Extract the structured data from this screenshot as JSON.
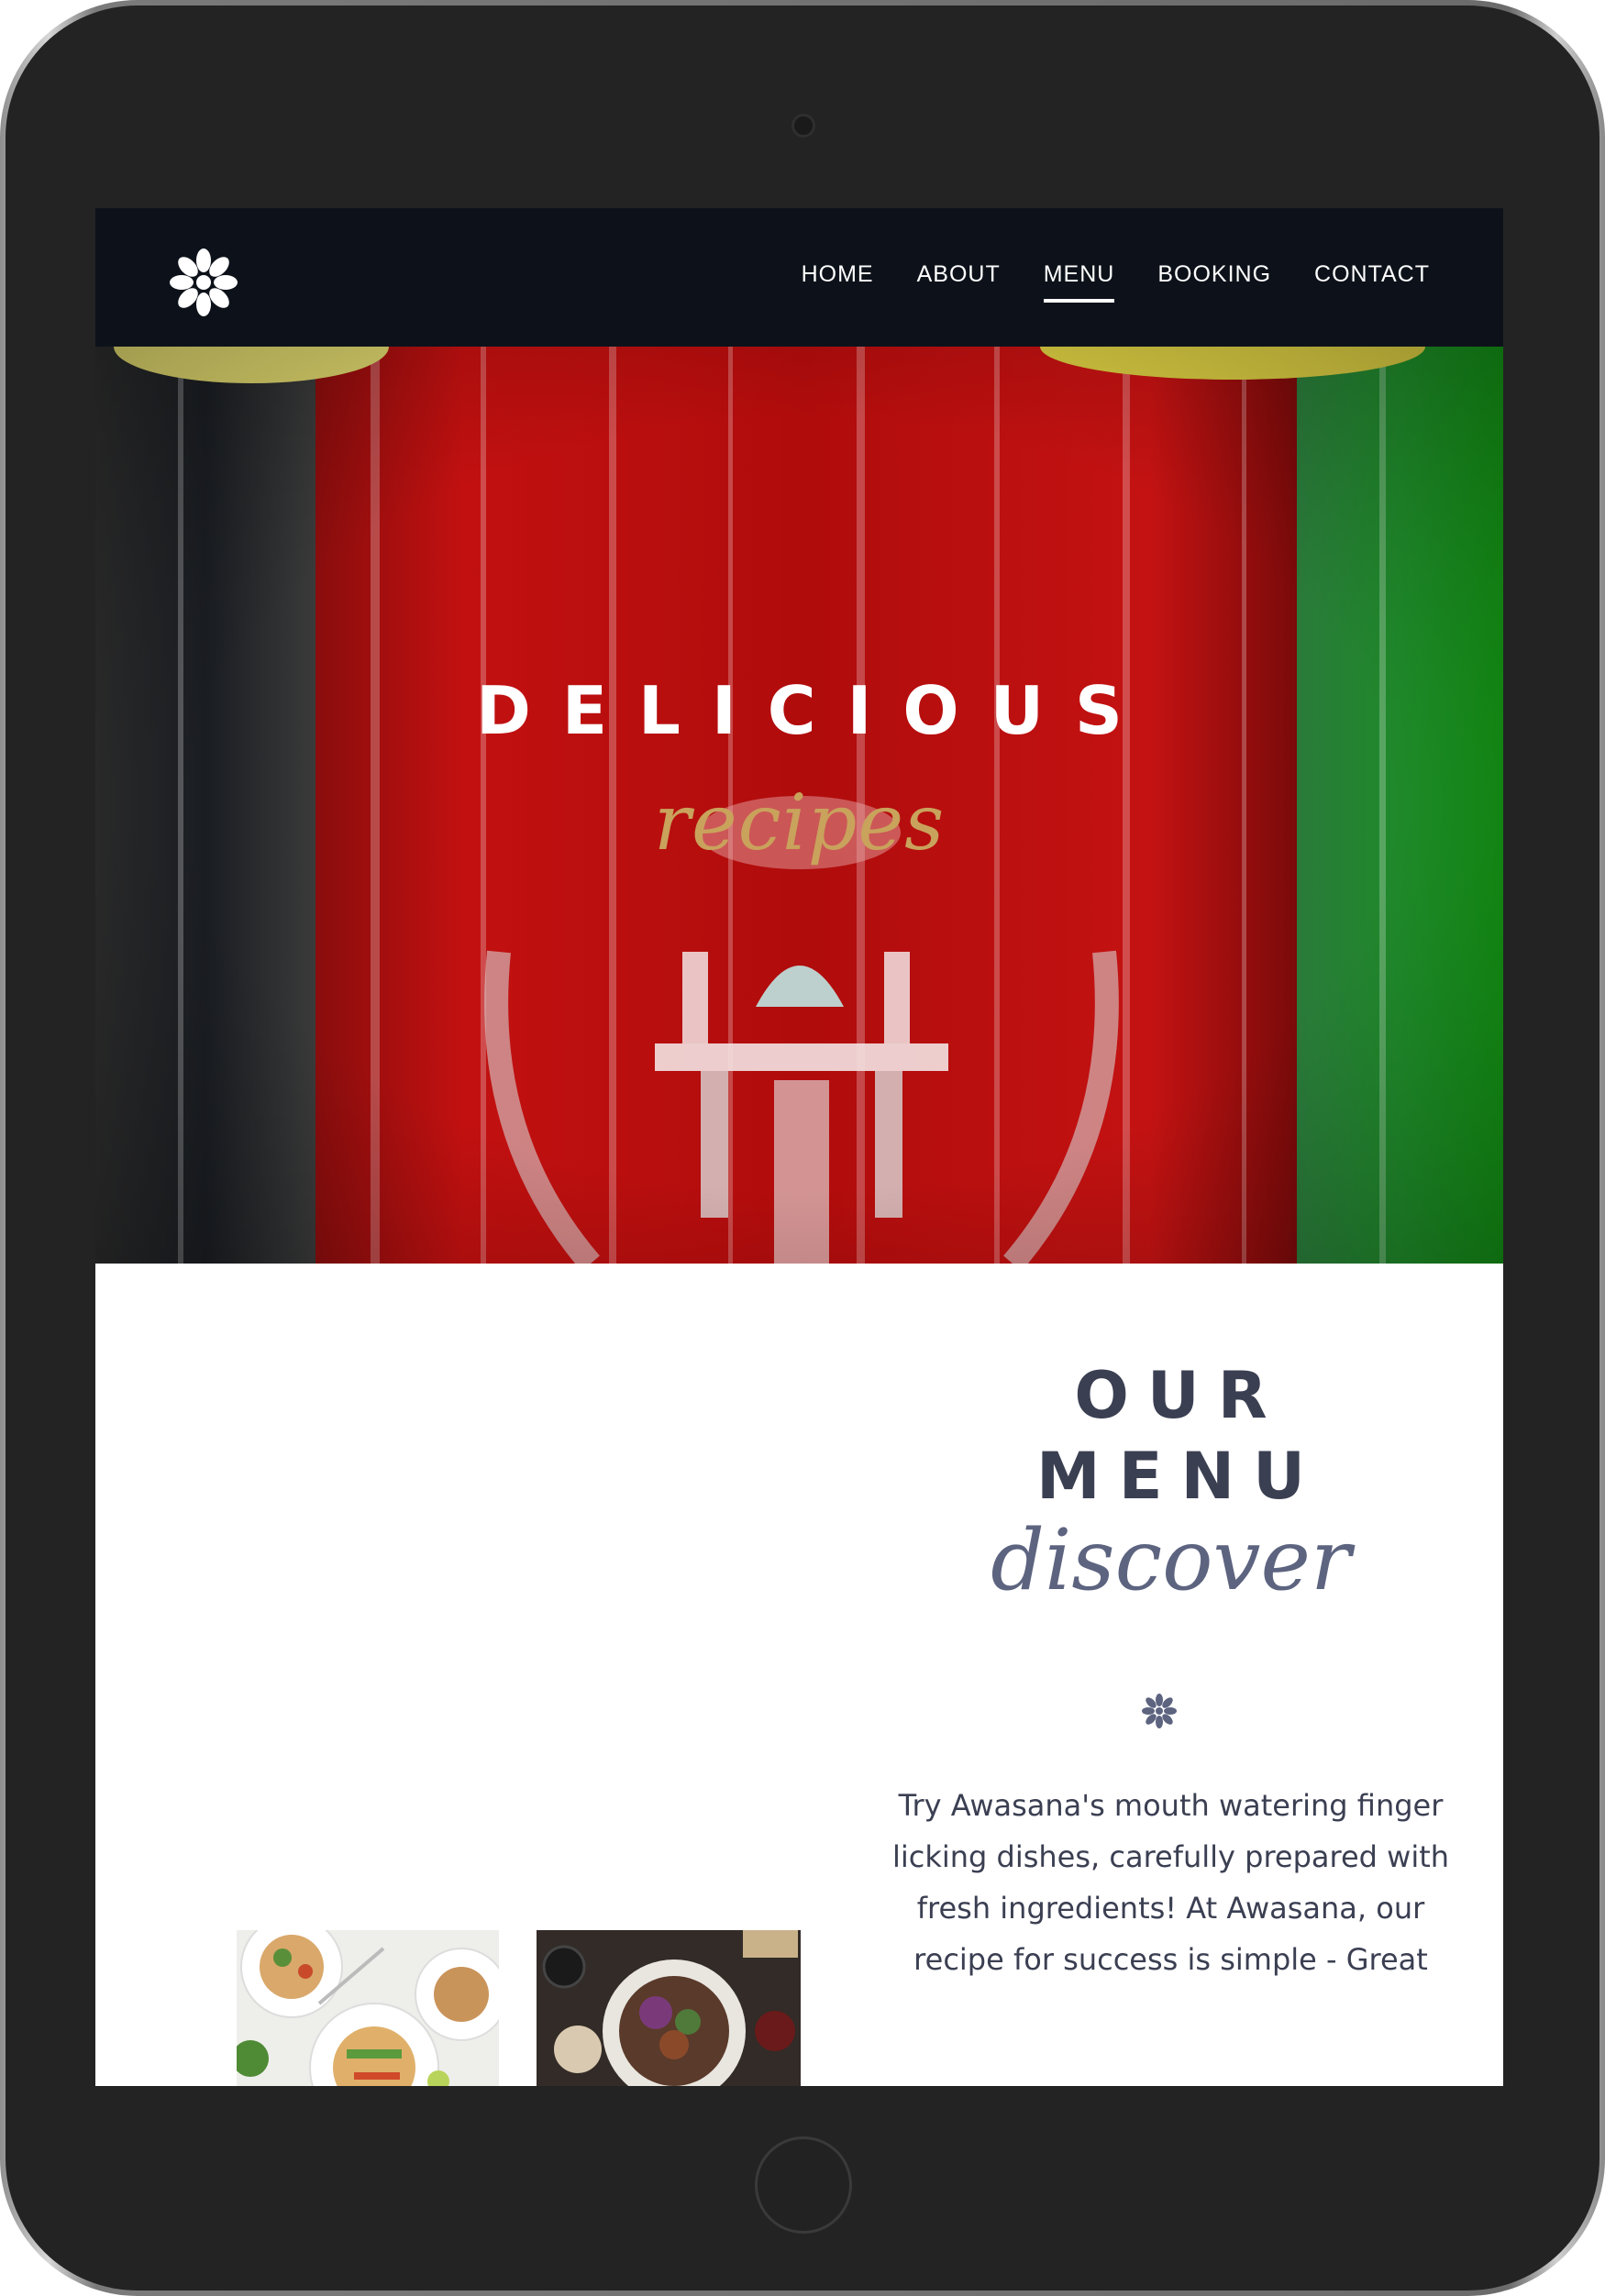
{
  "nav": {
    "links": [
      {
        "label": "HOME"
      },
      {
        "label": "ABOUT"
      },
      {
        "label": "MENU"
      },
      {
        "label": "BOOKING"
      },
      {
        "label": "CONTACT"
      }
    ],
    "active": "MENU"
  },
  "hero": {
    "title": "DELICIOUS",
    "script": "recipes"
  },
  "menu": {
    "heading_line1": "OUR",
    "heading_line2": "MENU",
    "script": "discover",
    "description": "Try Awasana's mouth watering finger licking dishes, carefully prepared with fresh ingredients! At Awasana, our recipe for success is simple - Great"
  },
  "colors": {
    "nav_bg": "#0d121a",
    "accent_gold": "#c9a25c",
    "heading": "#3b3f52",
    "script": "#5d6480"
  },
  "icons": {
    "logo": "asterisk-logo-icon",
    "divider": "asterisk-divider-icon"
  }
}
